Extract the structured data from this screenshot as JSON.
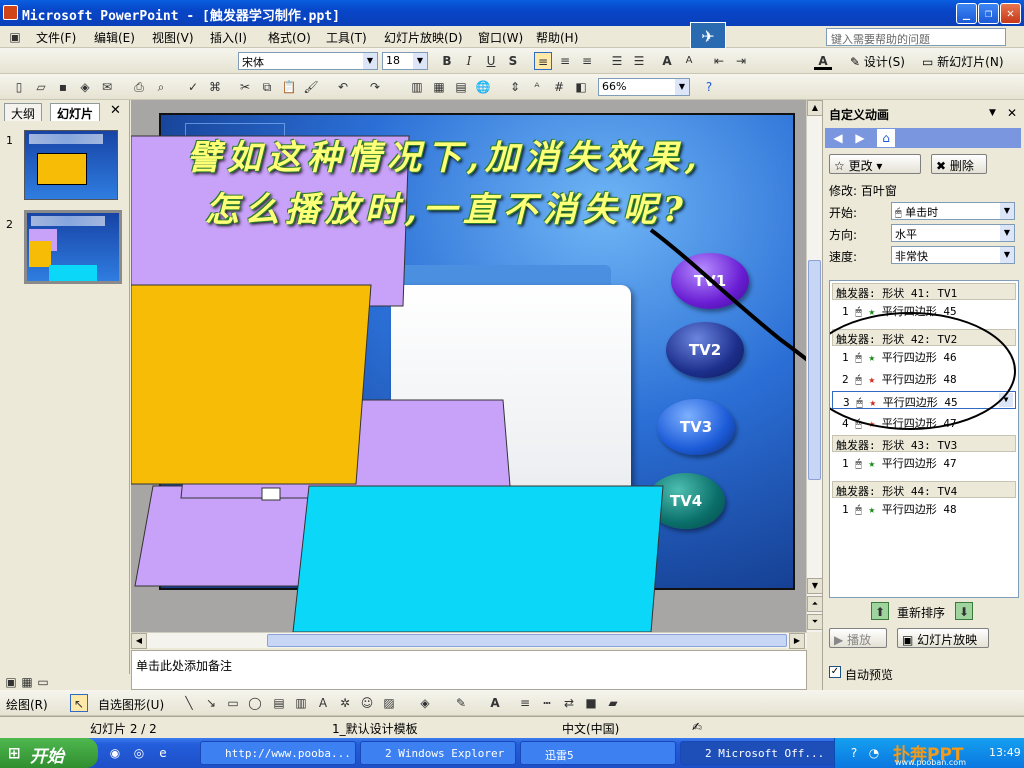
{
  "window": {
    "title": "Microsoft PowerPoint - [触发器学习制作.ppt]"
  },
  "menu": {
    "items": [
      "文件(F)",
      "编辑(E)",
      "视图(V)",
      "插入(I)",
      "格式(O)",
      "工具(T)",
      "幻灯片放映(D)",
      "窗口(W)",
      "帮助(H)"
    ],
    "help_placeholder": "键入需要帮助的问题"
  },
  "format_toolbar": {
    "font": "宋体",
    "size": "18",
    "bold": "B",
    "italic": "I",
    "underline": "U",
    "shadow": "S",
    "font_color": "A",
    "design": "设计(S)",
    "new_slide": "新幻灯片(N)"
  },
  "std_toolbar": {
    "zoom": "66%"
  },
  "left_pane": {
    "tab_outline": "大纲",
    "tab_slides": "幻灯片",
    "slides": [
      "1",
      "2"
    ]
  },
  "slide": {
    "line1": "譬如这种情况下,加消失效果,",
    "line2": "怎么播放时,一直不消失呢?",
    "buttons": [
      "TV1",
      "TV2",
      "TV3",
      "TV4"
    ]
  },
  "notes": {
    "placeholder": "单击此处添加备注"
  },
  "task_pane": {
    "title": "自定义动画",
    "change": "更改",
    "remove": "删除",
    "modify_label": "修改: 百叶窗",
    "start_label": "开始:",
    "start_value": "单击时",
    "direction_label": "方向:",
    "direction_value": "水平",
    "speed_label": "速度:",
    "speed_value": "非常快",
    "triggers": [
      {
        "header": "触发器: 形状 41: TV1",
        "items": [
          {
            "num": "1",
            "name": "平行四边形 45"
          }
        ]
      },
      {
        "header": "触发器: 形状 42: TV2",
        "items": [
          {
            "num": "1",
            "name": "平行四边形 46"
          },
          {
            "num": "2",
            "name": "平行四边形 48"
          },
          {
            "num": "3",
            "name": "平行四边形 45"
          },
          {
            "num": "4",
            "name": "平行四边形 47"
          }
        ]
      },
      {
        "header": "触发器: 形状 43: TV3",
        "items": [
          {
            "num": "1",
            "name": "平行四边形 47"
          }
        ]
      },
      {
        "header": "触发器: 形状 44: TV4",
        "items": [
          {
            "num": "1",
            "name": "平行四边形 48"
          }
        ]
      }
    ],
    "reorder": "重新排序",
    "play": "播放",
    "slideshow": "幻灯片放映",
    "autopreview": "自动预览"
  },
  "draw_toolbar": {
    "draw": "绘图(R)",
    "autoshapes": "自选图形(U)"
  },
  "status": {
    "slide": "幻灯片 2 / 2",
    "template": "1_默认设计模板",
    "lang": "中文(中国)"
  },
  "taskbar": {
    "start": "开始",
    "tasks": [
      "http://www.pooba...",
      "2 Windows Explorer",
      "迅雷5",
      "2 Microsoft Off..."
    ],
    "clock": "13:49",
    "watermark": "扑奔PPT",
    "watermark_url": "www.pooban.com"
  },
  "colors": {
    "lavender": "#c8a2f8",
    "gold": "#f7bd06",
    "cyan": "#0bd8f8",
    "xp_blue": "#0a5ee0"
  }
}
